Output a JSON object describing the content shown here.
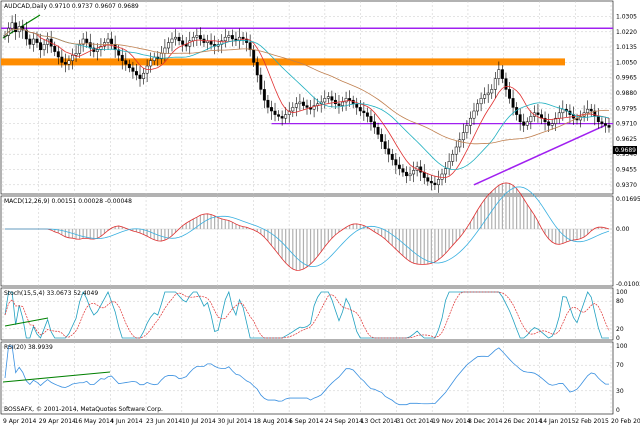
{
  "panels": {
    "main_title": "AUDCAD,Daily  0.9710 0.9737 0.9607 0.9689",
    "macd_title": "MACD(12,26,9) 0.00151 0.00028 -0.00048",
    "stoch_title": "Stoch(15,5,4) 33.0673 52.4049",
    "rsi_title": "RSI(20) 38.9939",
    "copyright": "BOSSAFX, © 2001-2014, MetaQuotes Software Corp."
  },
  "price_scale": [
    "1.0305",
    "1.0220",
    "1.0135",
    "1.0050",
    "0.9965",
    "0.9880",
    "0.9795",
    "0.9710",
    "0.9625",
    "0.9540",
    "0.9455",
    "0.9370"
  ],
  "price_current": "0.9689",
  "macd_scale": [
    "0.01695",
    "0.00",
    "-0.01003"
  ],
  "stoch_scale": [
    "100",
    "80",
    "20",
    "0"
  ],
  "rsi_scale": [
    "100",
    "70",
    "30",
    "0"
  ],
  "date_labels": [
    "9 Apr 2014",
    "29 Apr 2014",
    "16 May 2014",
    "4 Jun 2014",
    "23 Jun 2014",
    "10 Jul 2014",
    "30 Jul 2014",
    "18 Aug 2014",
    "5 Sep 2014",
    "24 Sep 2014",
    "13 Oct 2014",
    "31 Oct 2014",
    "19 Nov 2014",
    "8 Dec 2014",
    "26 Dec 2014",
    "14 Jan 2015",
    "2 Feb 2015",
    "20 Feb 2015"
  ],
  "colors": {
    "background": "#ffffff",
    "grid": "#c8c8c8",
    "candle": "#000000",
    "resistance_line": "#a020f0",
    "support_zone": "#ff8c00",
    "trend_line_green": "#008000",
    "ma_red": "#e03030",
    "ma_teal": "#20b0c0",
    "ma_tan": "#c08050",
    "macd_line": "#e03030",
    "macd_signal": "#3ab0e0",
    "macd_hist": "#b0b0b0",
    "stoch_main": "#20a0c0",
    "stoch_signal": "#e03030",
    "rsi_line": "#3a90e0"
  },
  "chart_data": {
    "type": "candlestick",
    "symbol": "AUDCAD",
    "timeframe": "Daily",
    "ohlc_last": {
      "open": 0.971,
      "high": 0.9737,
      "low": 0.9607,
      "close": 0.9689
    },
    "ylim": [
      0.933,
      1.033
    ],
    "closes": [
      1.02,
      1.024,
      1.027,
      1.022,
      1.025,
      1.023,
      1.018,
      1.015,
      1.018,
      1.016,
      1.012,
      1.015,
      1.018,
      1.014,
      1.011,
      1.008,
      1.005,
      1.004,
      1.006,
      1.009,
      1.01,
      1.015,
      1.018,
      1.016,
      1.013,
      1.011,
      1.012,
      1.014,
      1.016,
      1.018,
      1.015,
      1.012,
      1.009,
      1.006,
      1.004,
      1.002,
      1.0,
      0.998,
      0.996,
      0.999,
      1.003,
      1.006,
      1.008,
      1.007,
      1.01,
      1.013,
      1.016,
      1.018,
      1.019,
      1.017,
      1.015,
      1.014,
      1.017,
      1.019,
      1.02,
      1.018,
      1.016,
      1.017,
      1.015,
      1.014,
      1.015,
      1.017,
      1.019,
      1.02,
      1.018,
      1.017,
      1.019,
      1.018,
      1.016,
      1.012,
      1.005,
      0.998,
      0.99,
      0.984,
      0.98,
      0.978,
      0.976,
      0.975,
      0.974,
      0.976,
      0.978,
      0.98,
      0.982,
      0.983,
      0.981,
      0.98,
      0.979,
      0.981,
      0.982,
      0.983,
      0.985,
      0.986,
      0.984,
      0.982,
      0.981,
      0.983,
      0.985,
      0.984,
      0.982,
      0.98,
      0.978,
      0.977,
      0.975,
      0.972,
      0.969,
      0.965,
      0.961,
      0.957,
      0.954,
      0.951,
      0.948,
      0.946,
      0.944,
      0.942,
      0.943,
      0.945,
      0.947,
      0.944,
      0.941,
      0.939,
      0.938,
      0.937,
      0.94,
      0.943,
      0.946,
      0.95,
      0.954,
      0.958,
      0.962,
      0.966,
      0.97,
      0.974,
      0.978,
      0.982,
      0.985,
      0.987,
      0.988,
      0.99,
      0.996,
      1.001,
      0.996,
      0.99,
      0.985,
      0.98,
      0.976,
      0.972,
      0.97,
      0.972,
      0.975,
      0.977,
      0.976,
      0.974,
      0.972,
      0.97,
      0.971,
      0.974,
      0.977,
      0.979,
      0.978,
      0.976,
      0.974,
      0.973,
      0.975,
      0.977,
      0.979,
      0.978,
      0.975,
      0.972,
      0.971,
      0.97,
      0.9689
    ],
    "trend_lines": [
      {
        "name": "resistance",
        "y": 1.024
      },
      {
        "name": "support_high",
        "y": 1.005
      },
      {
        "name": "support_low",
        "y": 0.971
      },
      {
        "name": "rising_trend",
        "from": 0.937,
        "to": 0.97
      }
    ]
  }
}
